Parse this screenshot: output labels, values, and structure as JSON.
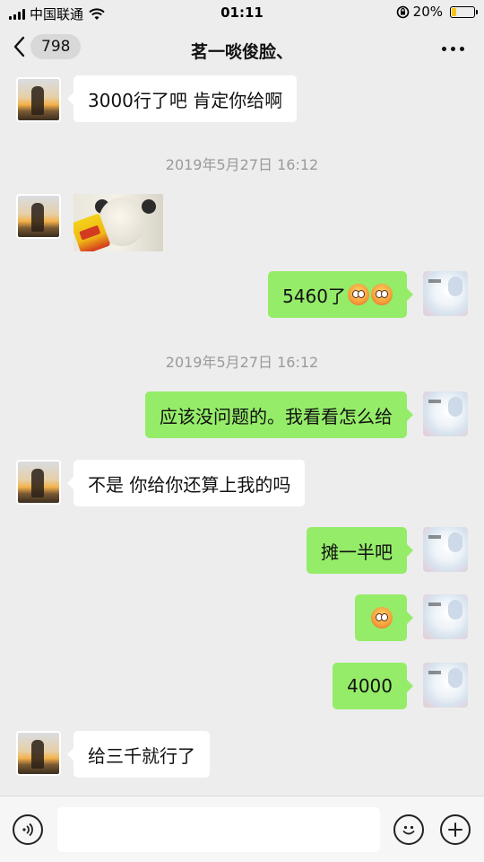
{
  "status_bar": {
    "carrier": "中国联通",
    "time": "01:11",
    "battery_percent": "20%",
    "battery_level": 0.2
  },
  "nav": {
    "unread_count": "798",
    "title": "茗一啖俊脸、"
  },
  "messages": {
    "m1": "3000行了吧  肯定你给啊",
    "ts1": "2019年5月27日 16:12",
    "m3": "5460了",
    "ts2": "2019年5月27日 16:12",
    "m4": "应该没问题的。我看看怎么给",
    "m5": "不是  你给你还算上我的吗",
    "m6": "摊一半吧",
    "m8": "4000",
    "m9": "给三千就行了"
  },
  "icons": {
    "back": "chevron-left-icon",
    "more": "more-icon",
    "voice": "voice-icon",
    "emoji": "emoji-icon",
    "plus": "plus-icon"
  },
  "colors": {
    "sent_bubble": "#95ec69",
    "received_bubble": "#ffffff",
    "background": "#ededed"
  }
}
